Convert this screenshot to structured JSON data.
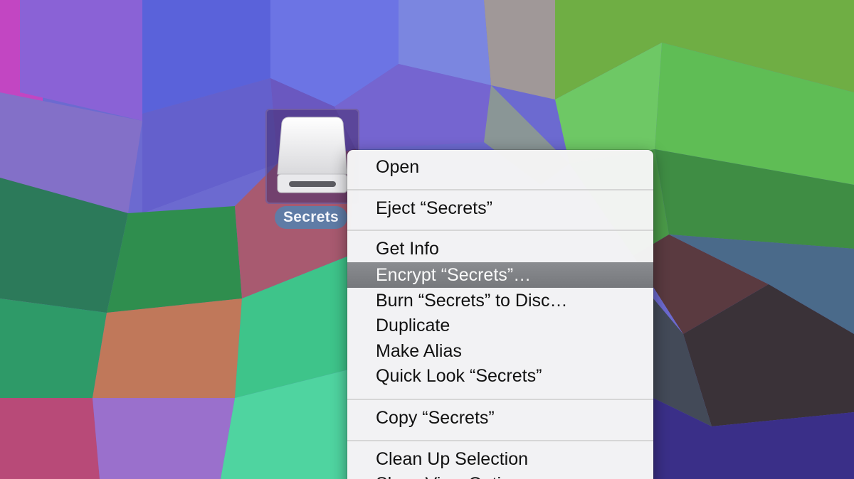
{
  "desktop": {
    "drive": {
      "icon": "external-drive-icon",
      "label": "Secrets"
    }
  },
  "context_menu": {
    "items": [
      {
        "label": "Open"
      },
      {
        "label": "Eject “Secrets”"
      },
      {
        "label": "Get Info"
      },
      {
        "label": "Encrypt “Secrets”…",
        "highlighted": true
      },
      {
        "label": "Burn “Secrets” to Disc…"
      },
      {
        "label": "Duplicate"
      },
      {
        "label": "Make Alias"
      },
      {
        "label": "Quick Look “Secrets”"
      },
      {
        "label": "Copy “Secrets”"
      },
      {
        "label": "Clean Up Selection"
      },
      {
        "label": "Show View Options"
      }
    ],
    "highlight_color": "#7e8084"
  }
}
